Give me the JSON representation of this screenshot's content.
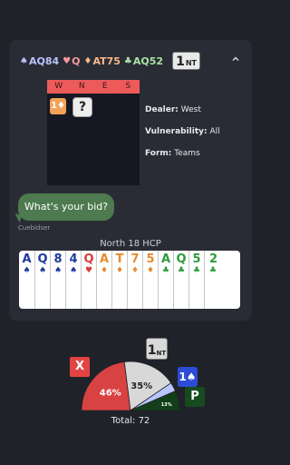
{
  "summary": {
    "spades": {
      "symbol": "♠",
      "cards": "AQ84"
    },
    "hearts": {
      "symbol": "♥",
      "cards": "Q"
    },
    "diamonds": {
      "symbol": "♦",
      "cards": "AT75"
    },
    "clubs": {
      "symbol": "♣",
      "cards": "AQ52"
    },
    "contract": {
      "level": "1",
      "strain": "NT"
    },
    "collapse_icon": "chevron-up-icon"
  },
  "auction": {
    "headers": [
      "W",
      "N",
      "E",
      "S"
    ],
    "bids": [
      {
        "text": "1♦"
      },
      {
        "text": "?"
      }
    ]
  },
  "info": {
    "dealer_label": "Dealer:",
    "dealer": "West",
    "vul_label": "Vulnerability:",
    "vul": "All",
    "form_label": "Form:",
    "form": "Teams"
  },
  "chat": {
    "message": "What's your bid?",
    "sender": "Cuebidser"
  },
  "hand": {
    "title": "North 18 HCP",
    "cards": [
      {
        "rank": "A",
        "suit": "♠",
        "color": "spade"
      },
      {
        "rank": "Q",
        "suit": "♠",
        "color": "spade"
      },
      {
        "rank": "8",
        "suit": "♠",
        "color": "spade"
      },
      {
        "rank": "4",
        "suit": "♠",
        "color": "spade"
      },
      {
        "rank": "Q",
        "suit": "♥",
        "color": "heart"
      },
      {
        "rank": "A",
        "suit": "♦",
        "color": "diam"
      },
      {
        "rank": "T",
        "suit": "♦",
        "color": "diam"
      },
      {
        "rank": "7",
        "suit": "♦",
        "color": "diam"
      },
      {
        "rank": "5",
        "suit": "♦",
        "color": "diam"
      },
      {
        "rank": "A",
        "suit": "♣",
        "color": "club"
      },
      {
        "rank": "Q",
        "suit": "♣",
        "color": "club"
      },
      {
        "rank": "5",
        "suit": "♣",
        "color": "club"
      },
      {
        "rank": "2",
        "suit": "♣",
        "color": "club"
      }
    ]
  },
  "votes": {
    "slices": [
      {
        "label": "X",
        "percent": 46,
        "percent_text": "46%",
        "color": "#d84242"
      },
      {
        "label": "1NT",
        "percent": 35,
        "percent_text": "35%",
        "color": "#d8d8d8"
      },
      {
        "label": "1♠",
        "percent": 6,
        "percent_text": "",
        "color": "#b9c6ff"
      },
      {
        "label": "P",
        "percent": 13,
        "percent_text": "13%",
        "color": "#123f19"
      }
    ],
    "tag_x": "X",
    "tag_1nt": {
      "level": "1",
      "strain": "NT"
    },
    "tag_1s": "1♠",
    "tag_p": "P",
    "total": "Total: 72"
  }
}
